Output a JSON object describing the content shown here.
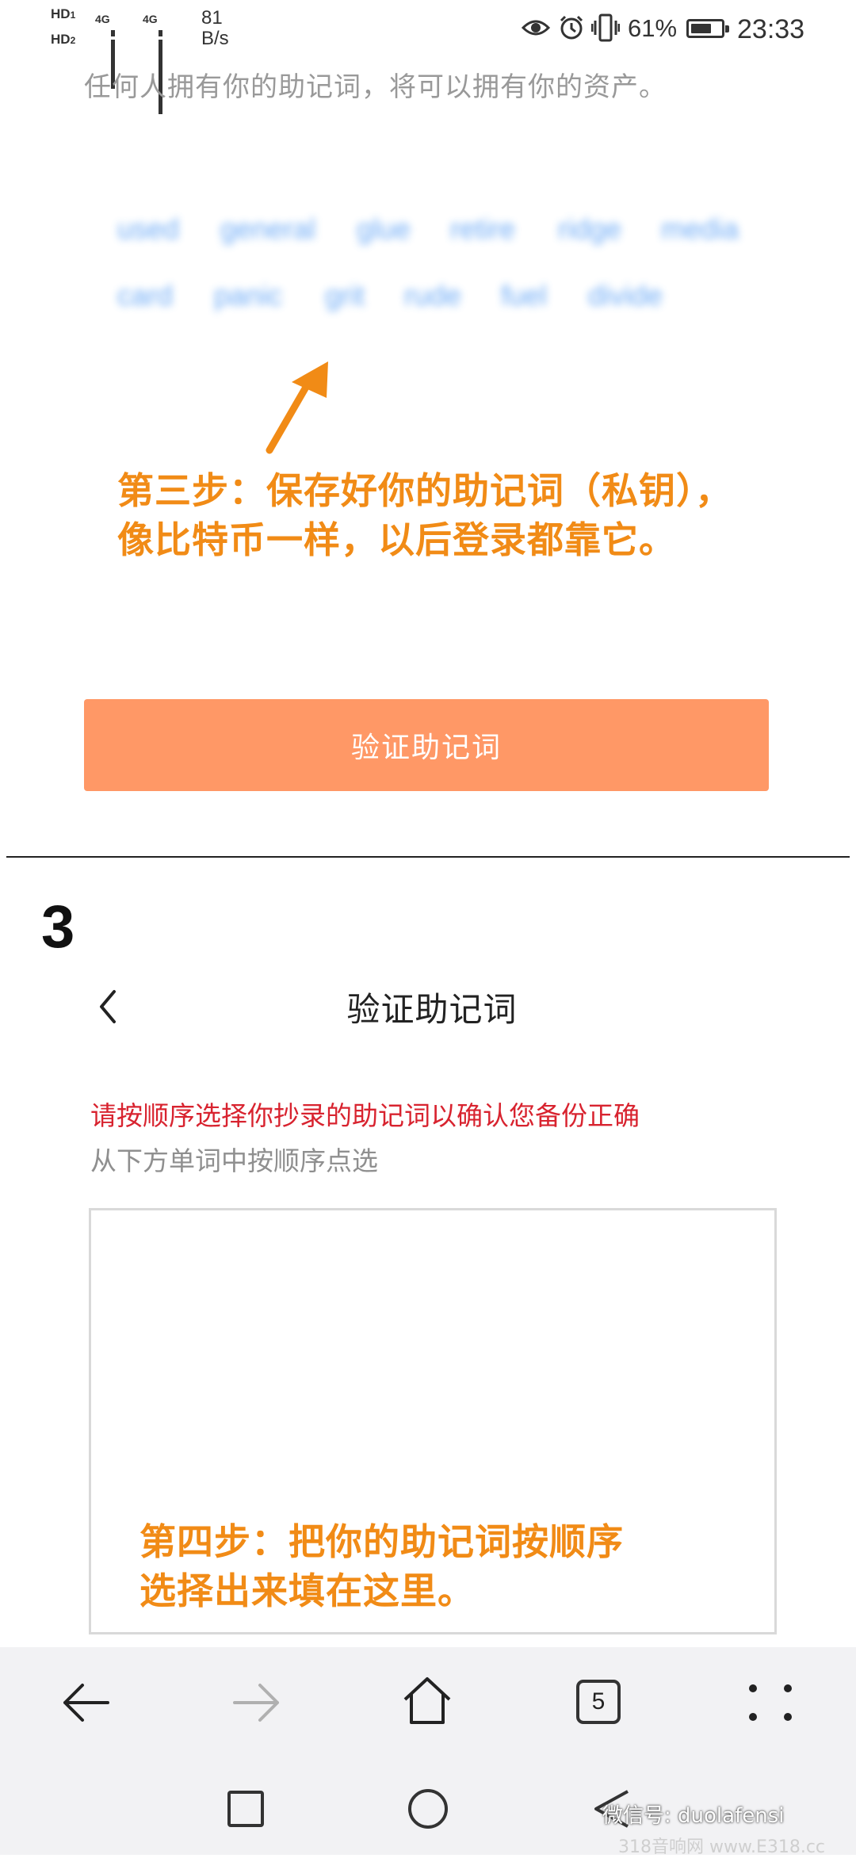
{
  "status_bar": {
    "hd1": "HD",
    "hd1_sub": "1",
    "hd2": "HD",
    "hd2_sub": "2",
    "network1": "4G",
    "network2": "4G",
    "speed_value": "81",
    "speed_unit": "B/s",
    "battery": "61%",
    "time": "23:33"
  },
  "backup": {
    "warning": "任何人拥有你的助记词，将可以拥有你的资产。",
    "words": [
      "used",
      "general",
      "glue",
      "retire",
      "ridge",
      "media",
      "card",
      "panic",
      "grit",
      "rude",
      "fuel",
      "divide"
    ],
    "annotation_line1": "第三步：保存好你的助记词（私钥），",
    "annotation_line2": "像比特币一样，以后登录都靠它。",
    "verify_button": "验证助记词"
  },
  "verify_page": {
    "step_number": "3",
    "title": "验证助记词",
    "instruction_red": "请按顺序选择你抄录的助记词以确认您备份正确",
    "instruction_gray": "从下方单词中按顺序点选",
    "annotation_line1": "第四步：把你的助记词按顺序",
    "annotation_line2": "选择出来填在这里。"
  },
  "browser": {
    "tab_count": "5"
  },
  "watermark": {
    "text": "微信号: duolafensi",
    "site": "318音响网 www.E318.cc"
  },
  "colors": {
    "accent_orange": "#ff9866",
    "annotation_orange": "#f18b16",
    "warning_red": "#d8232f",
    "blur_blue": "#3d8ff3"
  }
}
